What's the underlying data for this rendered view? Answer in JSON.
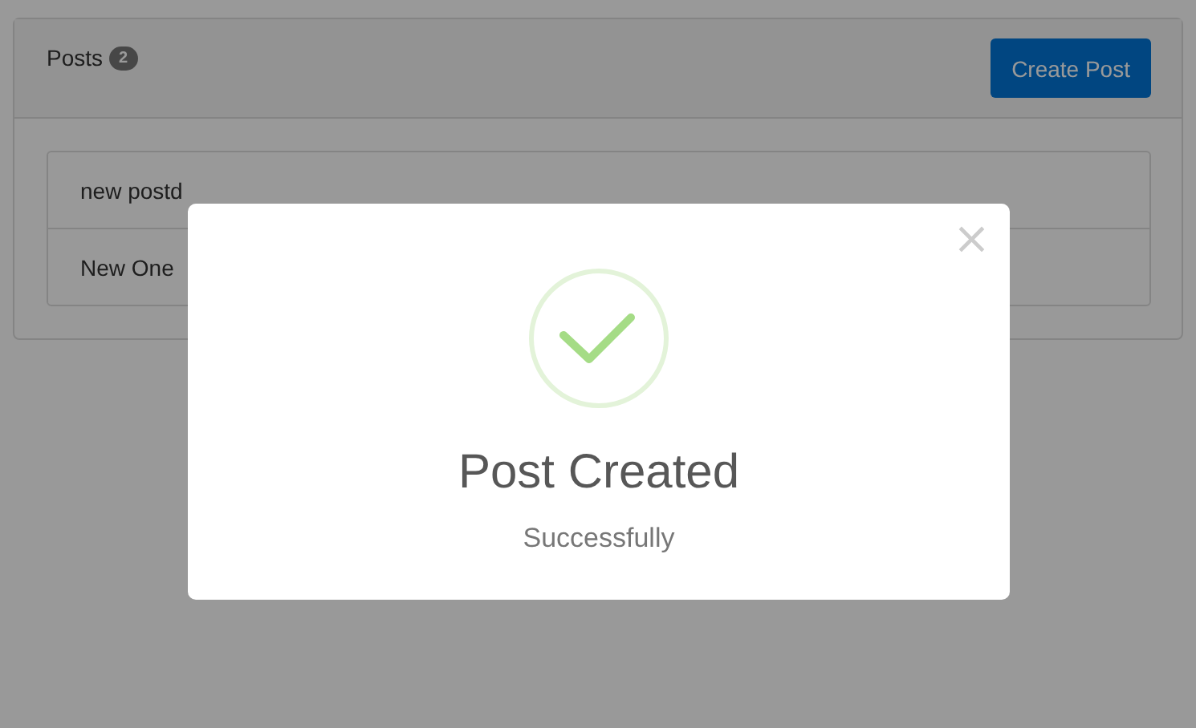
{
  "card": {
    "title": "Posts",
    "count": "2",
    "button": "Create Post"
  },
  "posts": [
    "new postd",
    "New One"
  ],
  "modal": {
    "title": "Post Created",
    "message": "Successfully",
    "close": "×"
  }
}
